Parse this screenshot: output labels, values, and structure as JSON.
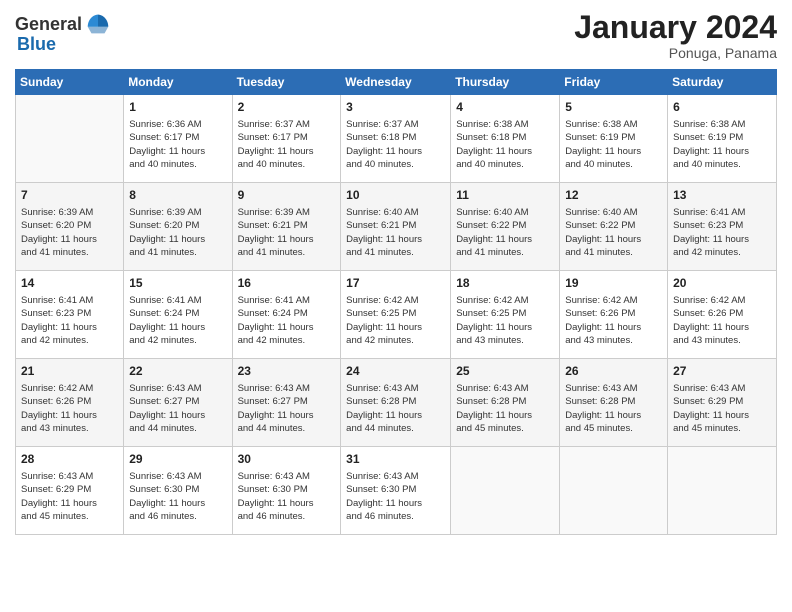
{
  "header": {
    "logo_general": "General",
    "logo_blue": "Blue",
    "month_title": "January 2024",
    "location": "Ponuga, Panama"
  },
  "days_of_week": [
    "Sunday",
    "Monday",
    "Tuesday",
    "Wednesday",
    "Thursday",
    "Friday",
    "Saturday"
  ],
  "weeks": [
    [
      {
        "day": "",
        "sunrise": "",
        "sunset": "",
        "daylight": "",
        "empty": true
      },
      {
        "day": "1",
        "sunrise": "Sunrise: 6:36 AM",
        "sunset": "Sunset: 6:17 PM",
        "daylight": "Daylight: 11 hours and 40 minutes."
      },
      {
        "day": "2",
        "sunrise": "Sunrise: 6:37 AM",
        "sunset": "Sunset: 6:17 PM",
        "daylight": "Daylight: 11 hours and 40 minutes."
      },
      {
        "day": "3",
        "sunrise": "Sunrise: 6:37 AM",
        "sunset": "Sunset: 6:18 PM",
        "daylight": "Daylight: 11 hours and 40 minutes."
      },
      {
        "day": "4",
        "sunrise": "Sunrise: 6:38 AM",
        "sunset": "Sunset: 6:18 PM",
        "daylight": "Daylight: 11 hours and 40 minutes."
      },
      {
        "day": "5",
        "sunrise": "Sunrise: 6:38 AM",
        "sunset": "Sunset: 6:19 PM",
        "daylight": "Daylight: 11 hours and 40 minutes."
      },
      {
        "day": "6",
        "sunrise": "Sunrise: 6:38 AM",
        "sunset": "Sunset: 6:19 PM",
        "daylight": "Daylight: 11 hours and 40 minutes."
      }
    ],
    [
      {
        "day": "7",
        "sunrise": "Sunrise: 6:39 AM",
        "sunset": "Sunset: 6:20 PM",
        "daylight": "Daylight: 11 hours and 41 minutes."
      },
      {
        "day": "8",
        "sunrise": "Sunrise: 6:39 AM",
        "sunset": "Sunset: 6:20 PM",
        "daylight": "Daylight: 11 hours and 41 minutes."
      },
      {
        "day": "9",
        "sunrise": "Sunrise: 6:39 AM",
        "sunset": "Sunset: 6:21 PM",
        "daylight": "Daylight: 11 hours and 41 minutes."
      },
      {
        "day": "10",
        "sunrise": "Sunrise: 6:40 AM",
        "sunset": "Sunset: 6:21 PM",
        "daylight": "Daylight: 11 hours and 41 minutes."
      },
      {
        "day": "11",
        "sunrise": "Sunrise: 6:40 AM",
        "sunset": "Sunset: 6:22 PM",
        "daylight": "Daylight: 11 hours and 41 minutes."
      },
      {
        "day": "12",
        "sunrise": "Sunrise: 6:40 AM",
        "sunset": "Sunset: 6:22 PM",
        "daylight": "Daylight: 11 hours and 41 minutes."
      },
      {
        "day": "13",
        "sunrise": "Sunrise: 6:41 AM",
        "sunset": "Sunset: 6:23 PM",
        "daylight": "Daylight: 11 hours and 42 minutes."
      }
    ],
    [
      {
        "day": "14",
        "sunrise": "Sunrise: 6:41 AM",
        "sunset": "Sunset: 6:23 PM",
        "daylight": "Daylight: 11 hours and 42 minutes."
      },
      {
        "day": "15",
        "sunrise": "Sunrise: 6:41 AM",
        "sunset": "Sunset: 6:24 PM",
        "daylight": "Daylight: 11 hours and 42 minutes."
      },
      {
        "day": "16",
        "sunrise": "Sunrise: 6:41 AM",
        "sunset": "Sunset: 6:24 PM",
        "daylight": "Daylight: 11 hours and 42 minutes."
      },
      {
        "day": "17",
        "sunrise": "Sunrise: 6:42 AM",
        "sunset": "Sunset: 6:25 PM",
        "daylight": "Daylight: 11 hours and 42 minutes."
      },
      {
        "day": "18",
        "sunrise": "Sunrise: 6:42 AM",
        "sunset": "Sunset: 6:25 PM",
        "daylight": "Daylight: 11 hours and 43 minutes."
      },
      {
        "day": "19",
        "sunrise": "Sunrise: 6:42 AM",
        "sunset": "Sunset: 6:26 PM",
        "daylight": "Daylight: 11 hours and 43 minutes."
      },
      {
        "day": "20",
        "sunrise": "Sunrise: 6:42 AM",
        "sunset": "Sunset: 6:26 PM",
        "daylight": "Daylight: 11 hours and 43 minutes."
      }
    ],
    [
      {
        "day": "21",
        "sunrise": "Sunrise: 6:42 AM",
        "sunset": "Sunset: 6:26 PM",
        "daylight": "Daylight: 11 hours and 43 minutes."
      },
      {
        "day": "22",
        "sunrise": "Sunrise: 6:43 AM",
        "sunset": "Sunset: 6:27 PM",
        "daylight": "Daylight: 11 hours and 44 minutes."
      },
      {
        "day": "23",
        "sunrise": "Sunrise: 6:43 AM",
        "sunset": "Sunset: 6:27 PM",
        "daylight": "Daylight: 11 hours and 44 minutes."
      },
      {
        "day": "24",
        "sunrise": "Sunrise: 6:43 AM",
        "sunset": "Sunset: 6:28 PM",
        "daylight": "Daylight: 11 hours and 44 minutes."
      },
      {
        "day": "25",
        "sunrise": "Sunrise: 6:43 AM",
        "sunset": "Sunset: 6:28 PM",
        "daylight": "Daylight: 11 hours and 45 minutes."
      },
      {
        "day": "26",
        "sunrise": "Sunrise: 6:43 AM",
        "sunset": "Sunset: 6:28 PM",
        "daylight": "Daylight: 11 hours and 45 minutes."
      },
      {
        "day": "27",
        "sunrise": "Sunrise: 6:43 AM",
        "sunset": "Sunset: 6:29 PM",
        "daylight": "Daylight: 11 hours and 45 minutes."
      }
    ],
    [
      {
        "day": "28",
        "sunrise": "Sunrise: 6:43 AM",
        "sunset": "Sunset: 6:29 PM",
        "daylight": "Daylight: 11 hours and 45 minutes."
      },
      {
        "day": "29",
        "sunrise": "Sunrise: 6:43 AM",
        "sunset": "Sunset: 6:30 PM",
        "daylight": "Daylight: 11 hours and 46 minutes."
      },
      {
        "day": "30",
        "sunrise": "Sunrise: 6:43 AM",
        "sunset": "Sunset: 6:30 PM",
        "daylight": "Daylight: 11 hours and 46 minutes."
      },
      {
        "day": "31",
        "sunrise": "Sunrise: 6:43 AM",
        "sunset": "Sunset: 6:30 PM",
        "daylight": "Daylight: 11 hours and 46 minutes."
      },
      {
        "day": "",
        "sunrise": "",
        "sunset": "",
        "daylight": "",
        "empty": true
      },
      {
        "day": "",
        "sunrise": "",
        "sunset": "",
        "daylight": "",
        "empty": true
      },
      {
        "day": "",
        "sunrise": "",
        "sunset": "",
        "daylight": "",
        "empty": true
      }
    ]
  ]
}
